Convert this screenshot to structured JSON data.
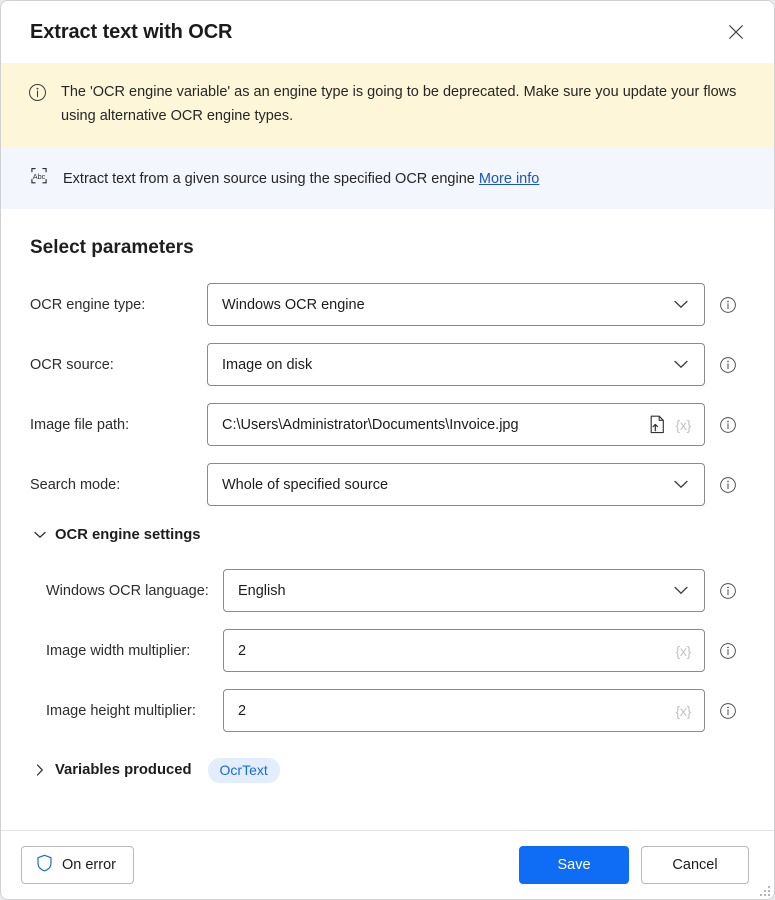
{
  "window": {
    "title": "Extract text with OCR",
    "close_label": "Close"
  },
  "warning": {
    "icon": "info-circle-icon",
    "text": "The 'OCR engine variable' as an engine type is going to be deprecated.  Make sure you update your flows using alternative OCR engine types."
  },
  "description": {
    "icon": "abc-brackets-icon",
    "text": "Extract text from a given source using the specified OCR engine",
    "link_label": "More info"
  },
  "main": {
    "section_heading": "Select parameters",
    "fields": [
      {
        "label": "OCR engine type:",
        "value": "Windows OCR engine",
        "control": "dropdown",
        "name": "ocr-engine-type"
      },
      {
        "label": "OCR source:",
        "value": "Image on disk",
        "control": "dropdown",
        "name": "ocr-source"
      },
      {
        "label": "Image file path:",
        "value": "C:\\Users\\Administrator\\Documents\\Invoice.jpg",
        "control": "file-text",
        "variable_label": "{x}",
        "name": "image-file-path"
      },
      {
        "label": "Search mode:",
        "value": "Whole of specified source",
        "control": "dropdown",
        "name": "search-mode"
      }
    ],
    "engine_settings": {
      "title": "OCR engine settings",
      "expanded": true,
      "fields": [
        {
          "label": "Windows OCR language:",
          "value": "English",
          "control": "dropdown",
          "name": "windows-ocr-language"
        },
        {
          "label": "Image width multiplier:",
          "value": "2",
          "control": "text",
          "variable_label": "{x}",
          "name": "image-width-multiplier"
        },
        {
          "label": "Image height multiplier:",
          "value": "2",
          "control": "text",
          "variable_label": "{x}",
          "name": "image-height-multiplier"
        }
      ]
    },
    "variables_produced": {
      "title": "Variables produced",
      "expanded": false,
      "badges": [
        "OcrText"
      ]
    }
  },
  "footer": {
    "on_error_label": "On error",
    "save_label": "Save",
    "cancel_label": "Cancel"
  },
  "colors": {
    "accent": "#0f6cf5",
    "warning_bg": "#fdf6d9",
    "info_bg": "#f3f6fd",
    "link": "#1a56c4",
    "badge_bg": "#e3eefc",
    "badge_text": "#1a6ae0"
  }
}
